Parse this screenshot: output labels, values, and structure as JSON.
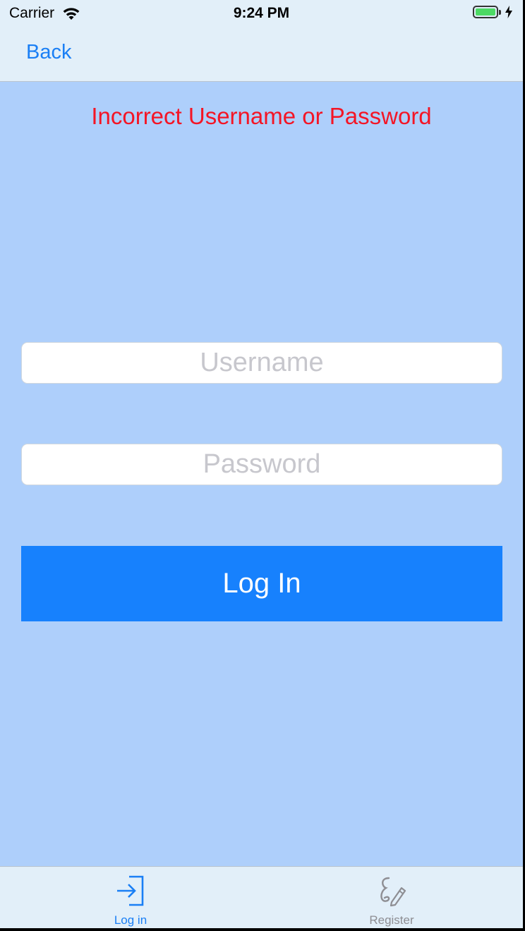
{
  "status_bar": {
    "carrier": "Carrier",
    "time": "9:24 PM",
    "battery_level": 1.0
  },
  "nav": {
    "back_label": "Back"
  },
  "error_message": "Incorrect Username or Password",
  "form": {
    "username_placeholder": "Username",
    "username_value": "",
    "password_placeholder": "Password",
    "password_value": "",
    "login_label": "Log In"
  },
  "tabs": [
    {
      "label": "Log in",
      "icon": "login-arrow-icon",
      "selected": true
    },
    {
      "label": "Register",
      "icon": "signature-icon",
      "selected": false
    }
  ],
  "colors": {
    "accent": "#1a7ff5",
    "button": "#1781fd",
    "background": "#aecffb",
    "bars": "#e2eff9",
    "error": "#f41525",
    "inactive_tab": "#8e8e93"
  }
}
